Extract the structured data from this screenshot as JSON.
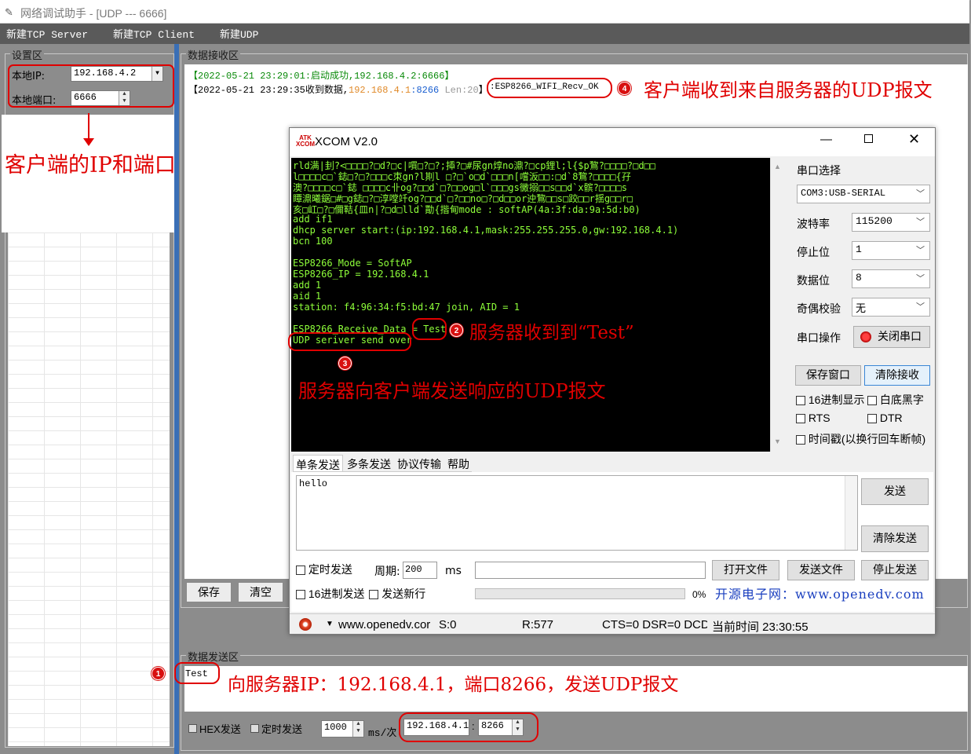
{
  "window": {
    "title": "网络调试助手 - [UDP --- 6666]",
    "menu": [
      "新建TCP Server",
      "新建TCP Client",
      "新建UDP"
    ]
  },
  "settings": {
    "group_title": "设置区",
    "local_ip_label": "本地IP:",
    "local_ip": "192.168.4.2",
    "local_port_label": "本地端口:",
    "local_port": "6666"
  },
  "receive": {
    "group_title": "数据接收区",
    "line1": "【2022-05-21 23:29:01:启动成功,192.168.4.2:6666】",
    "line2_prefix": "【2022-05-21 23:29:35收到数据,",
    "line2_addr": "192.168.4.1",
    "line2_port": ":8266",
    "line2_len": " Len:20",
    "line2_suffix": "】",
    "line2_payload": ":ESP8266_WIFI_Recv_OK",
    "save_button": "保存",
    "clear_button": "清空"
  },
  "send": {
    "group_title": "数据发送区",
    "text": "Test",
    "hex_label": "HEX发送",
    "timed_label": "定时发送",
    "interval": "1000",
    "interval_unit": "ms/次",
    "target_ip": "192.168.4.1",
    "target_port": "8266"
  },
  "annotations": {
    "client_ip_port": "客户端的IP和端口",
    "client_received": "客户端收到来自服务器的UDP报文",
    "server_received": "服务器收到到“Test”",
    "server_sent": "服务器向客户端发送响应的UDP报文",
    "send_to_server": "向服务器IP：192.168.4.1，端口8266，发送UDP报文",
    "markers": [
      "1",
      "2",
      "3",
      "4"
    ]
  },
  "xcom": {
    "title": "XCOM V2.0",
    "terminal_lines": [
      "rld满|刲?<□□□□?□d?□c|嘪□?□?;揷?□#尿gn焞no濎?□cp鋰l;l{$p鵹?□□□□?□d□□",
      "l□□□□c□`鋕□?□?□□□c朿gn?l剘l □?□`o□d`□□□n[嚐汳□□:□d`8鵹?□□□□{孖",
      "澳?□□□□c□`鋕 □□□□c卝og?□□d`□?□□og□l`□□□gs黴搦□□s□□d`x髌?□□□□s",
      "瞫濎曦鋸□#□g鋕□?□淳嘡竏og?□□d`□?□□no□?□d□□or迚鵹□□s□跤□□r揺g□□r□",
      "亥□屸□?□儞鞊{皿n|?□d□lld`勩{揩甸mode : softAP(4a:3f:da:9a:5d:b0)",
      "add if1",
      "dhcp server start:(ip:192.168.4.1,mask:255.255.255.0,gw:192.168.4.1)",
      "bcn 100",
      "",
      "ESP8266_Mode = SoftAP",
      "ESP8266_IP = 192.168.4.1",
      "add 1",
      "aid 1",
      "station: f4:96:34:f5:bd:47 join, AID = 1",
      "",
      "ESP8266_Receive_Data = Test",
      "UDP seriver send over"
    ],
    "port_select_label": "串口选择",
    "port_value": "COM3:USB-SERIAL",
    "baud_label": "波特率",
    "baud_value": "115200",
    "stop_label": "停止位",
    "stop_value": "1",
    "data_label": "数据位",
    "data_value": "8",
    "parity_label": "奇偶校验",
    "parity_value": "无",
    "port_op_label": "串口操作",
    "close_port_button": "关闭串口",
    "save_window_button": "保存窗口",
    "clear_recv_button": "清除接收",
    "hex_display": "16进制显示",
    "white_bg": "白底黑字",
    "rts": "RTS",
    "dtr": "DTR",
    "timestamp": "时间戳(以换行回车断帧)",
    "tabs": [
      "单条发送",
      "多条发送",
      "协议传输",
      "帮助"
    ],
    "send_text": "hello",
    "send_button": "发送",
    "clear_send_button": "清除发送",
    "timed_send": "定时发送",
    "period_label": "周期:",
    "period_value": "200",
    "period_unit": "ms",
    "open_file_button": "打开文件",
    "send_file_button": "发送文件",
    "stop_send_button": "停止发送",
    "hex_send": "16进制发送",
    "send_newline": "发送新行",
    "progress_percent": "0%",
    "progress_value": 0,
    "website_label": "开源电子网：www.openedv.com",
    "status": {
      "url": "www.openedv.cor",
      "sent": "S:0",
      "received": "R:577",
      "signals": "CTS=0 DSR=0 DCD=",
      "time": "当前时间 23:30:55"
    }
  }
}
